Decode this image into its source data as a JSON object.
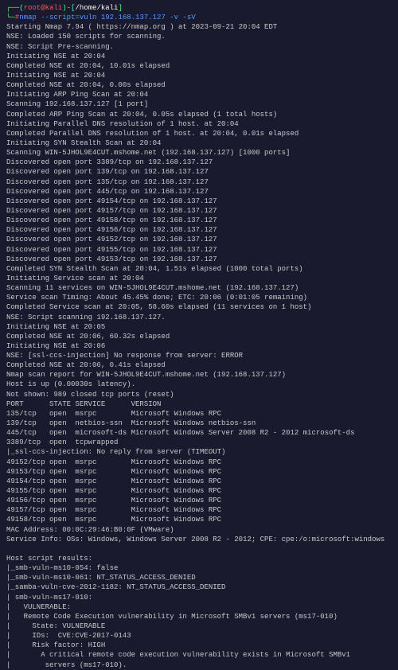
{
  "prompt": {
    "open_paren": "┌──(",
    "user": "root",
    "at": "@",
    "host": "kali",
    "close_paren": ")-[",
    "path": "/home/kali",
    "closing": "]",
    "line2_prefix": "└─",
    "hash": "# ",
    "command": "nmap --script=vuln 192.168.137.127 -v -sV"
  },
  "output": "Starting Nmap 7.94 ( https://nmap.org ) at 2023-09-21 20:04 EDT\nNSE: Loaded 150 scripts for scanning.\nNSE: Script Pre-scanning.\nInitiating NSE at 20:04\nCompleted NSE at 20:04, 10.01s elapsed\nInitiating NSE at 20:04\nCompleted NSE at 20:04, 0.00s elapsed\nInitiating ARP Ping Scan at 20:04\nScanning 192.168.137.127 [1 port]\nCompleted ARP Ping Scan at 20:04, 0.05s elapsed (1 total hosts)\nInitiating Parallel DNS resolution of 1 host. at 20:04\nCompleted Parallel DNS resolution of 1 host. at 20:04, 0.01s elapsed\nInitiating SYN Stealth Scan at 20:04\nScanning WIN-5JHOL9E4CUT.mshome.net (192.168.137.127) [1000 ports]\nDiscovered open port 3389/tcp on 192.168.137.127\nDiscovered open port 139/tcp on 192.168.137.127\nDiscovered open port 135/tcp on 192.168.137.127\nDiscovered open port 445/tcp on 192.168.137.127\nDiscovered open port 49154/tcp on 192.168.137.127\nDiscovered open port 49157/tcp on 192.168.137.127\nDiscovered open port 49158/tcp on 192.168.137.127\nDiscovered open port 49156/tcp on 192.168.137.127\nDiscovered open port 49152/tcp on 192.168.137.127\nDiscovered open port 49155/tcp on 192.168.137.127\nDiscovered open port 49153/tcp on 192.168.137.127\nCompleted SYN Stealth Scan at 20:04, 1.51s elapsed (1000 total ports)\nInitiating Service scan at 20:04\nScanning 11 services on WIN-5JHOL9E4CUT.mshome.net (192.168.137.127)\nService scan Timing: About 45.45% done; ETC: 20:06 (0:01:05 remaining)\nCompleted Service scan at 20:05, 58.60s elapsed (11 services on 1 host)\nNSE: Script scanning 192.168.137.127.\nInitiating NSE at 20:05\nCompleted NSE at 20:06, 60.32s elapsed\nInitiating NSE at 20:06\nNSE: [ssl-ccs-injection] No response from server: ERROR\nCompleted NSE at 20:06, 0.41s elapsed\nNmap scan report for WIN-5JHOL9E4CUT.mshome.net (192.168.137.127)\nHost is up (0.00030s latency).\nNot shown: 989 closed tcp ports (reset)\nPORT      STATE SERVICE      VERSION\n135/tcp   open  msrpc        Microsoft Windows RPC\n139/tcp   open  netbios-ssn  Microsoft Windows netbios-ssn\n445/tcp   open  microsoft-ds Microsoft Windows Server 2008 R2 - 2012 microsoft-ds\n3389/tcp  open  tcpwrapped\n|_ssl-ccs-injection: No reply from server (TIMEOUT)\n49152/tcp open  msrpc        Microsoft Windows RPC\n49153/tcp open  msrpc        Microsoft Windows RPC\n49154/tcp open  msrpc        Microsoft Windows RPC\n49155/tcp open  msrpc        Microsoft Windows RPC\n49156/tcp open  msrpc        Microsoft Windows RPC\n49157/tcp open  msrpc        Microsoft Windows RPC\n49158/tcp open  msrpc        Microsoft Windows RPC\nMAC Address: 00:0C:29:46:B0:0F (VMware)\nService Info: OSs: Windows, Windows Server 2008 R2 - 2012; CPE: cpe:/o:microsoft:windows\n\nHost script results:\n|_smb-vuln-ms10-054: false\n|_smb-vuln-ms10-061: NT_STATUS_ACCESS_DENIED\n|_samba-vuln-cve-2012-1182: NT_STATUS_ACCESS_DENIED\n| smb-vuln-ms17-010: \n|   VULNERABLE:\n|   Remote Code Execution vulnerability in Microsoft SMBv1 servers (ms17-010)\n|     State: VULNERABLE\n|     IDs:  CVE:CVE-2017-0143\n|     Risk factor: HIGH\n|       A critical remote code execution vulnerability exists in Microsoft SMBv1\n|        servers (ms17-010)."
}
